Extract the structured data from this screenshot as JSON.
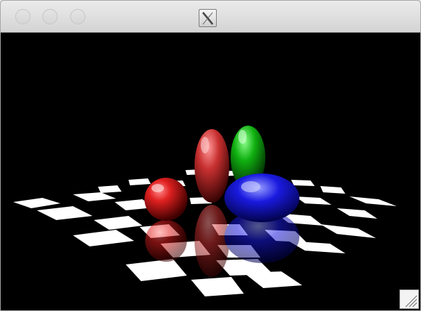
{
  "window": {
    "title_text": "",
    "title_icon": "x11-app-icon",
    "buttons": [
      "close-button",
      "minimize-button",
      "zoom-button"
    ]
  },
  "scene": {
    "description_icon": "raytraced-spheres",
    "floor": "checkerboard",
    "objects": [
      {
        "name": "red-sphere",
        "color": "#c81414"
      },
      {
        "name": "red-ellipsoid",
        "color": "#c83030"
      },
      {
        "name": "green-ellipsoid",
        "color": "#10a010"
      },
      {
        "name": "blue-ellipsoid",
        "color": "#1a1ad8"
      }
    ]
  },
  "colors": {
    "background": "#000000",
    "titlebar": "#e0e0e0"
  }
}
